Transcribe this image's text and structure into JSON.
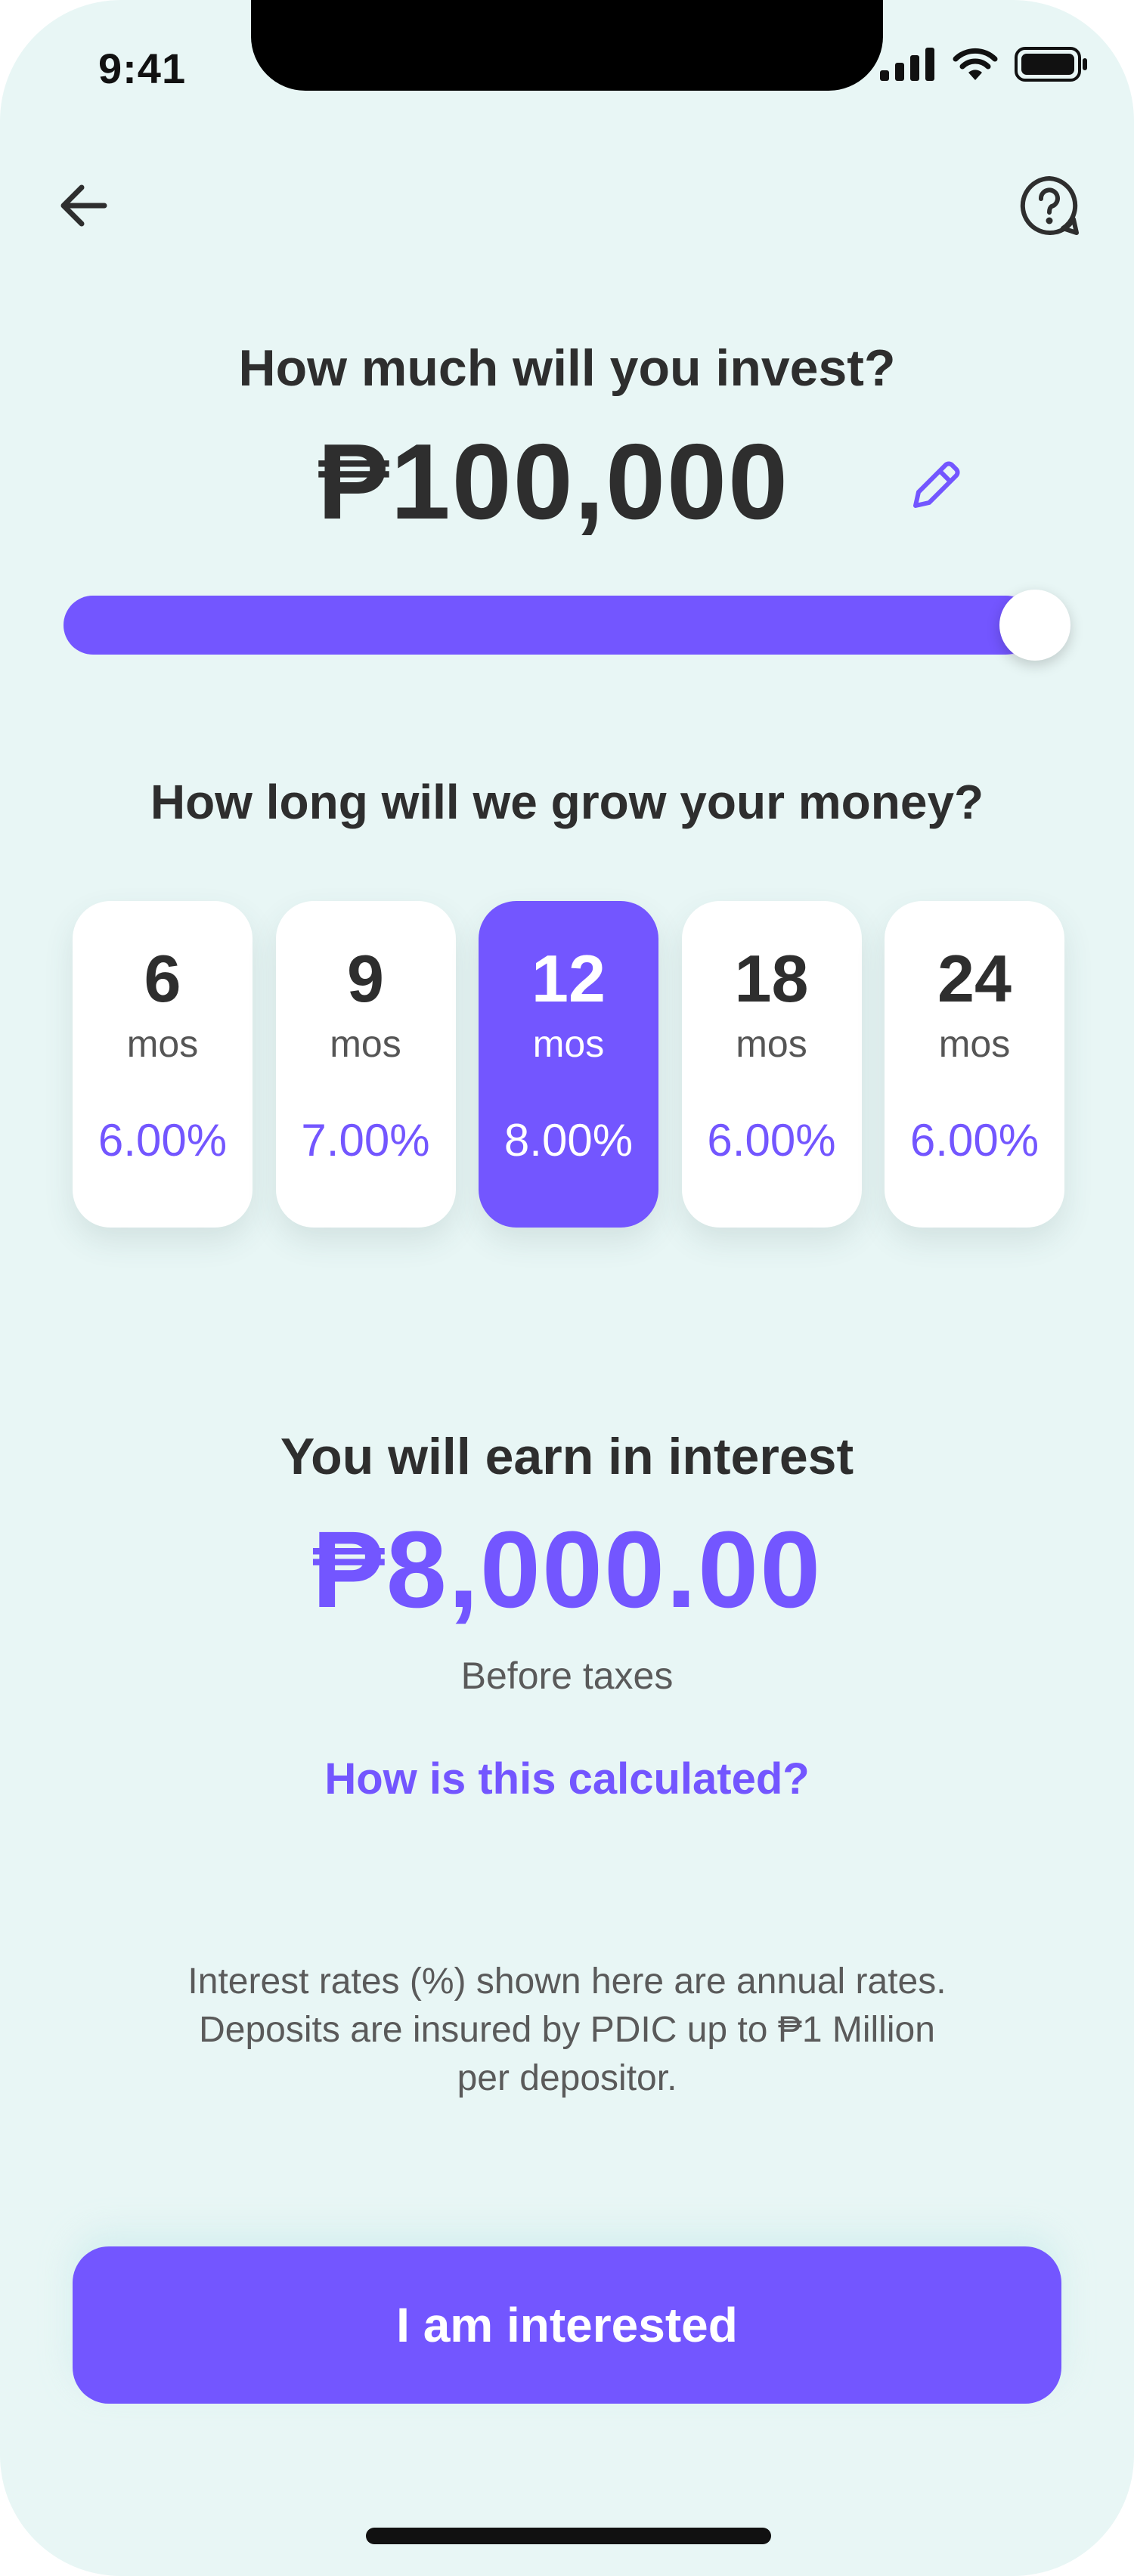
{
  "status_bar": {
    "time": "9:41"
  },
  "header": {
    "back_icon": "arrow-left-icon",
    "help_icon": "question-bubble-icon"
  },
  "investment": {
    "question": "How much will you invest?",
    "amount": "₱100,000",
    "edit_icon": "pencil-icon",
    "slider_percent": 100
  },
  "term": {
    "question": "How long will we grow your money?",
    "selected_index": 2,
    "options": [
      {
        "months": "6",
        "unit": "mos",
        "rate": "6.00%"
      },
      {
        "months": "9",
        "unit": "mos",
        "rate": "7.00%"
      },
      {
        "months": "12",
        "unit": "mos",
        "rate": "8.00%"
      },
      {
        "months": "18",
        "unit": "mos",
        "rate": "6.00%"
      },
      {
        "months": "24",
        "unit": "mos",
        "rate": "6.00%"
      }
    ]
  },
  "result": {
    "title": "You will earn in interest",
    "amount": "₱8,000.00",
    "note": "Before taxes",
    "calc_link": "How is this calculated?"
  },
  "disclaimer": {
    "line1": "Interest rates (%) shown here are annual rates.",
    "line2": "Deposits are insured by PDIC up to ₱1 Million",
    "line3": "per depositor."
  },
  "cta": {
    "label": "I am interested"
  },
  "colors": {
    "accent": "#7356FF",
    "background": "#E8F6F5",
    "text": "#2E2E2E"
  }
}
